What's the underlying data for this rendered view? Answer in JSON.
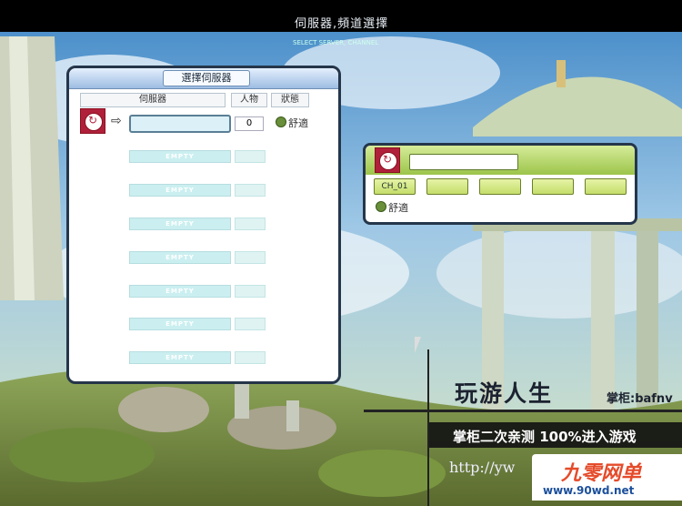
{
  "header": {
    "title": "伺服器,頻道選擇",
    "subtitle": "SELECT SERVER, CHANNEL"
  },
  "server_panel": {
    "title": "選擇伺服器",
    "columns": [
      "伺服器",
      "人物",
      "狀態"
    ],
    "selected_server": {
      "name": "",
      "count": "0",
      "status": "舒適"
    },
    "empty_label": "EMPTY",
    "empty_rows": [
      "EMPTY",
      "EMPTY",
      "EMPTY",
      "EMPTY",
      "EMPTY",
      "EMPTY",
      "EMPTY"
    ]
  },
  "channel_panel": {
    "name": "",
    "channels": [
      "CH_01",
      "",
      "",
      "",
      ""
    ],
    "status": "舒適"
  },
  "overlay": {
    "brand": "玩游人生",
    "keeper": "掌柜:bafnv",
    "slogan": "掌柜二次亲测 100%进入游戏",
    "url": "http://yw",
    "watermark_logo": "九零网单",
    "watermark_url": "www.90wd.net"
  },
  "colors": {
    "panel_border": "#25364a",
    "channel_header": "#9cc44a",
    "empty_slot": "#cbeff0",
    "emblem": "#b0203b"
  }
}
